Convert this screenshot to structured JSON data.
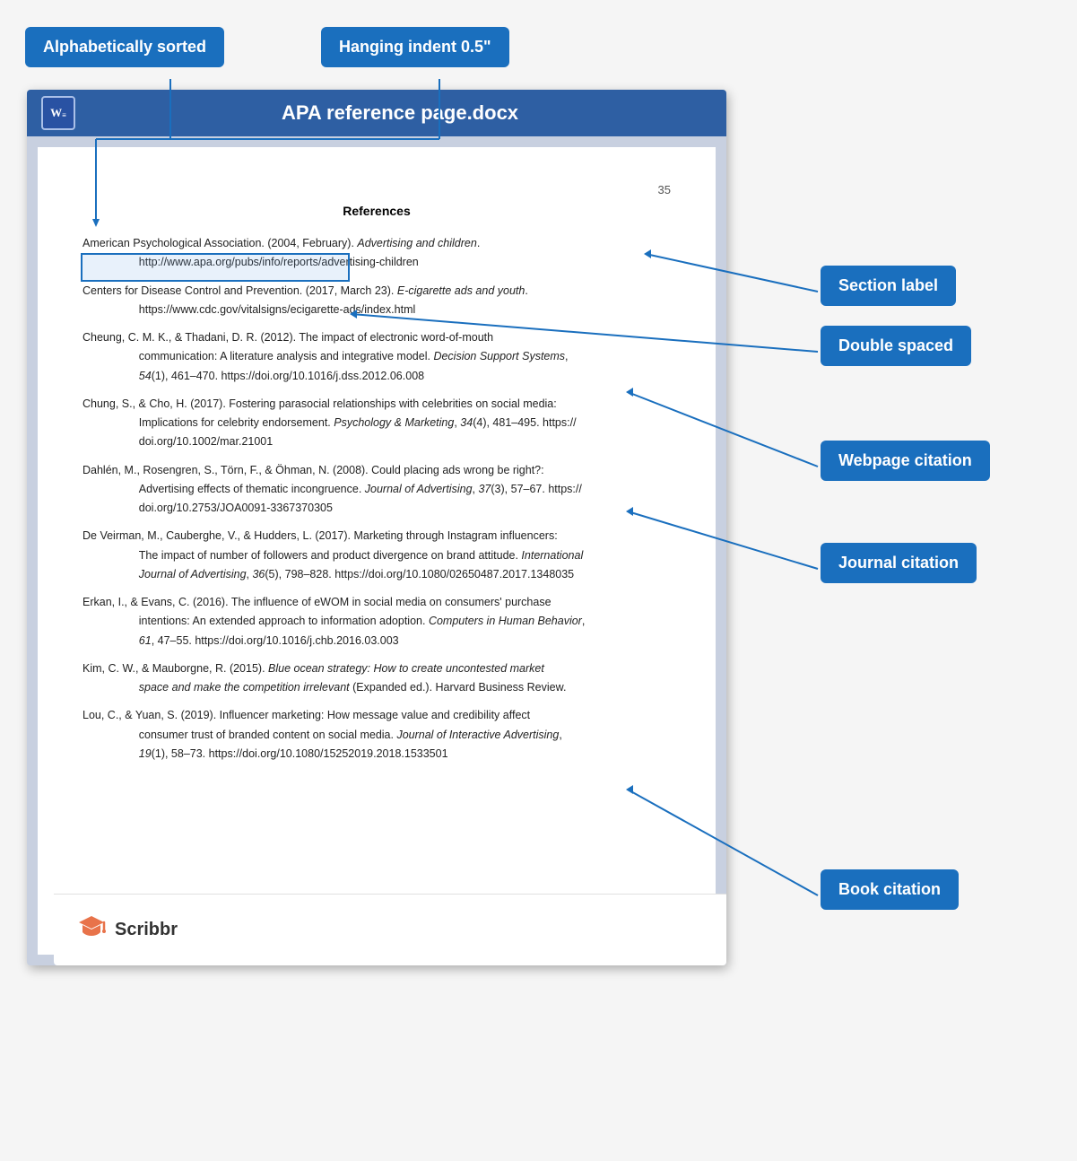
{
  "labels": {
    "alphabetically_sorted": "Alphabetically sorted",
    "hanging_indent": "Hanging indent 0.5\"",
    "section_label": "Section label",
    "double_spaced": "Double spaced",
    "webpage_citation": "Webpage citation",
    "journal_citation": "Journal citation",
    "book_citation": "Book citation"
  },
  "word": {
    "title": "APA reference page.docx",
    "icon": "W",
    "page_number": "35",
    "references_heading": "References"
  },
  "citations": [
    {
      "id": "american",
      "text_parts": [
        {
          "text": "American Psychological Association. (2004, February). ",
          "style": "normal"
        },
        {
          "text": "Advertising and children",
          "style": "italic"
        },
        {
          "text": ".\n        http://www.apa.org/pubs/info/reports/advertising-children",
          "style": "normal"
        }
      ]
    },
    {
      "id": "centers",
      "text_parts": [
        {
          "text": "Centers for Disease Control and Prevention. (2017, March 23). ",
          "style": "normal"
        },
        {
          "text": "E-cigarette ads and youth",
          "style": "italic"
        },
        {
          "text": ".\n        https://www.cdc.gov/vitalsigns/ecigarette-ads/index.html",
          "style": "normal"
        }
      ]
    },
    {
      "id": "cheung",
      "text_parts": [
        {
          "text": "Cheung, C. M. K., & Thadani, D. R. (2012). The impact of electronic word-of-mouth\n        communication: A literature analysis and integrative model. ",
          "style": "normal"
        },
        {
          "text": "Decision Support Systems",
          "style": "italic"
        },
        {
          "text": ",\n        ",
          "style": "normal"
        },
        {
          "text": "54",
          "style": "italic"
        },
        {
          "text": "(1), 461–470. https://doi.org/10.1016/j.dss.2012.06.008",
          "style": "normal"
        }
      ]
    },
    {
      "id": "chung",
      "text_parts": [
        {
          "text": "Chung, S., & Cho, H. (2017). Fostering parasocial relationships with celebrities on social media:\n        Implications for celebrity endorsement. ",
          "style": "normal"
        },
        {
          "text": "Psychology & Marketing",
          "style": "italic"
        },
        {
          "text": ", ",
          "style": "normal"
        },
        {
          "text": "34",
          "style": "italic"
        },
        {
          "text": "(4), 481–495. https://\n        doi.org/10.1002/mar.21001",
          "style": "normal"
        }
      ]
    },
    {
      "id": "dahlen",
      "text_parts": [
        {
          "text": "Dahlén, M., Rosengren, S., Törn, F., & Öhman, N. (2008). Could placing ads wrong be right?:\n        Advertising effects of thematic incongruence. ",
          "style": "normal"
        },
        {
          "text": "Journal of Advertising",
          "style": "italic"
        },
        {
          "text": ", ",
          "style": "normal"
        },
        {
          "text": "37",
          "style": "italic"
        },
        {
          "text": "(3), 57–67. https://\n        doi.org/10.2753/JOA0091-3367370305",
          "style": "normal"
        }
      ]
    },
    {
      "id": "deveirman",
      "text_parts": [
        {
          "text": "De Veirman, M., Cauberghe, V., & Hudders, L. (2017). Marketing through Instagram influencers:\n        The impact of number of followers and product divergence on brand attitude. ",
          "style": "normal"
        },
        {
          "text": "International\n        Journal of Advertising",
          "style": "italic"
        },
        {
          "text": ", ",
          "style": "normal"
        },
        {
          "text": "36",
          "style": "italic"
        },
        {
          "text": "(5), 798–828. https://doi.org/10.1080/02650487.2017.1348035",
          "style": "normal"
        }
      ]
    },
    {
      "id": "erkan",
      "text_parts": [
        {
          "text": "Erkan, I., & Evans, C. (2016). The influence of eWOM in social media on consumers' purchase\n        intentions: An extended approach to information adoption. ",
          "style": "normal"
        },
        {
          "text": "Computers in Human Behavior",
          "style": "italic"
        },
        {
          "text": ",\n        ",
          "style": "normal"
        },
        {
          "text": "61",
          "style": "italic"
        },
        {
          "text": ", 47–55. https://doi.org/10.1016/j.chb.2016.03.003",
          "style": "normal"
        }
      ]
    },
    {
      "id": "kim",
      "text_parts": [
        {
          "text": "Kim, C. W., & Mauborgne, R. (2015). ",
          "style": "normal"
        },
        {
          "text": "Blue ocean strategy: How to create uncontested market\n        space and make the competition irrelevant",
          "style": "italic"
        },
        {
          "text": " (Expanded ed.). Harvard Business Review.",
          "style": "normal"
        }
      ]
    },
    {
      "id": "lou",
      "text_parts": [
        {
          "text": "Lou, C., & Yuan, S. (2019). Influencer marketing: How message value and credibility affect\n        consumer trust of branded content on social media. ",
          "style": "normal"
        },
        {
          "text": "Journal of Interactive Advertising",
          "style": "italic"
        },
        {
          "text": ",\n        ",
          "style": "normal"
        },
        {
          "text": "19",
          "style": "italic"
        },
        {
          "text": "(1), 58–73. https://doi.org/10.1080/15252019.2018.1533501",
          "style": "normal"
        }
      ]
    }
  ],
  "scribbr": {
    "name": "Scribbr"
  }
}
